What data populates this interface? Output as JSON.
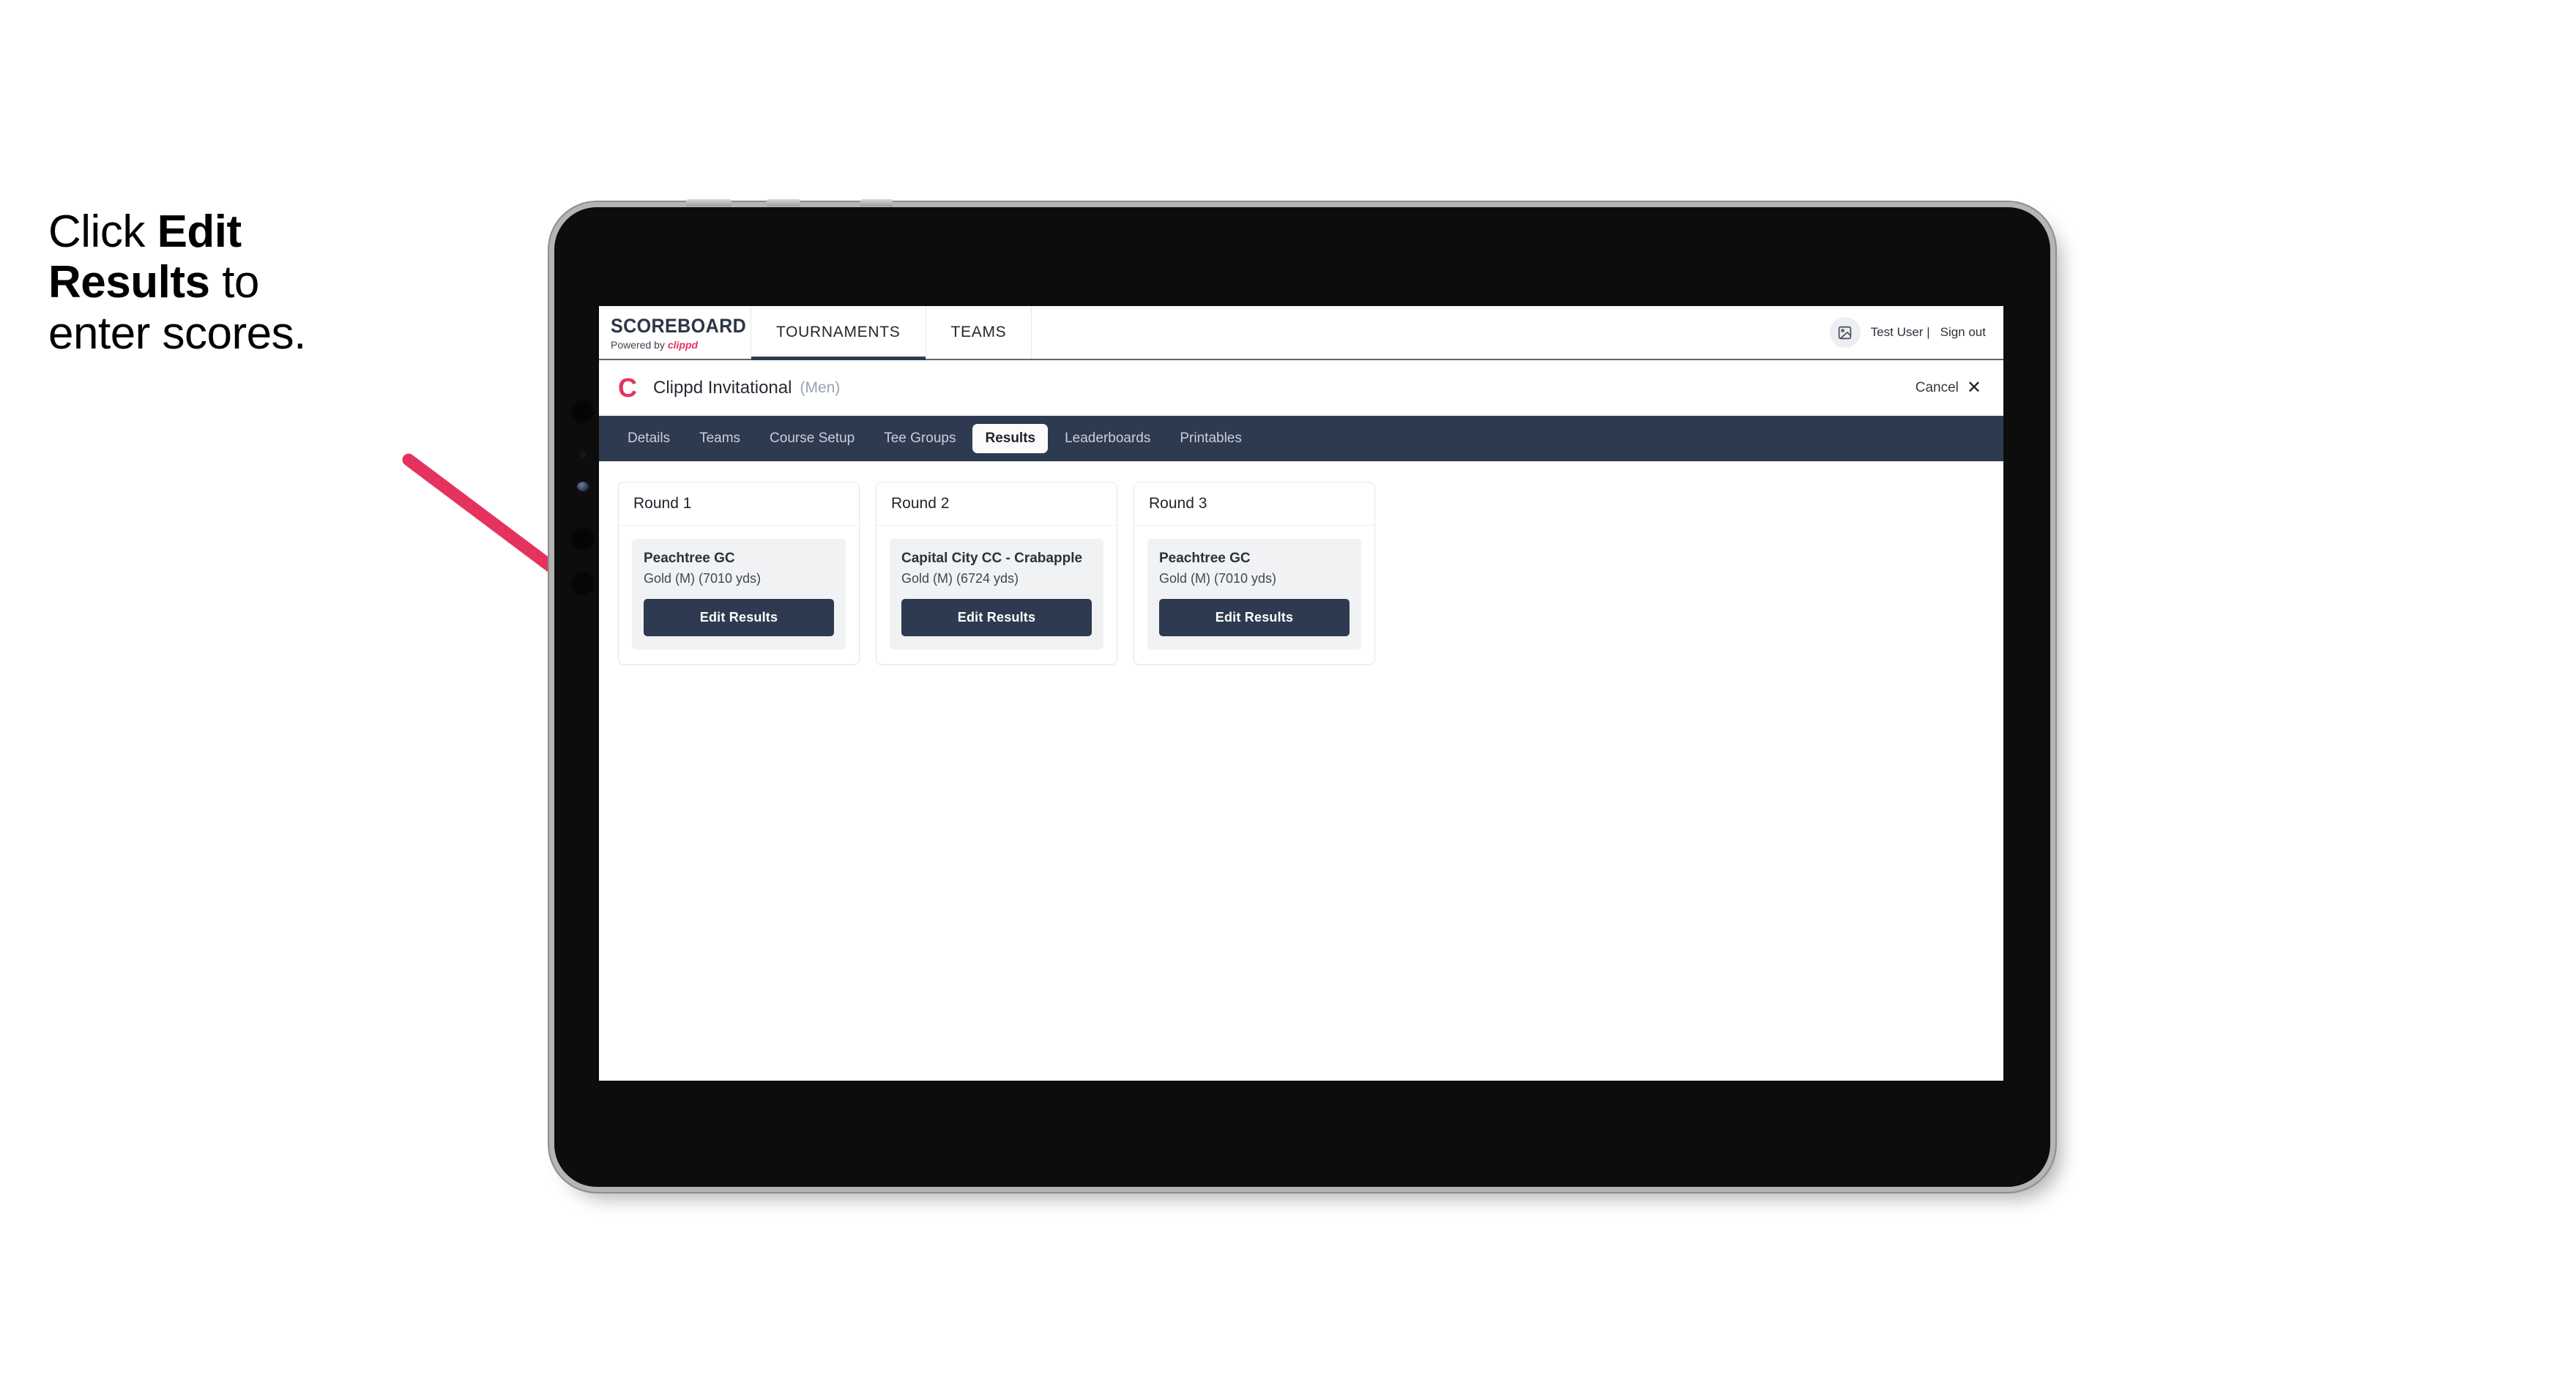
{
  "annotation": {
    "line1_prefix": "Click ",
    "line1_bold": "Edit",
    "line2_bold": "Results",
    "line2_suffix": " to",
    "line3": "enter scores.",
    "arrow_color": "#e5335f"
  },
  "topbar": {
    "brand_title": "SCOREBOARD",
    "brand_powered_prefix": "Powered by ",
    "brand_powered_name": "clippd",
    "tabs": [
      {
        "label": "TOURNAMENTS",
        "active": true
      },
      {
        "label": "TEAMS",
        "active": false
      }
    ],
    "avatar_icon": "image-placeholder-icon",
    "user_name": "Test User |",
    "sign_out": "Sign out"
  },
  "subheader": {
    "logo_letter": "C",
    "tournament_name": "Clippd Invitational",
    "gender": "(Men)",
    "cancel_label": "Cancel",
    "cancel_icon": "close-x-icon"
  },
  "tabstrip": {
    "tabs": [
      {
        "label": "Details",
        "active": false
      },
      {
        "label": "Teams",
        "active": false
      },
      {
        "label": "Course Setup",
        "active": false
      },
      {
        "label": "Tee Groups",
        "active": false
      },
      {
        "label": "Results",
        "active": true
      },
      {
        "label": "Leaderboards",
        "active": false
      },
      {
        "label": "Printables",
        "active": false
      }
    ]
  },
  "rounds": [
    {
      "header": "Round 1",
      "course_name": "Peachtree GC",
      "tee_info": "Gold (M) (7010 yds)",
      "button_label": "Edit Results"
    },
    {
      "header": "Round 2",
      "course_name": "Capital City CC - Crabapple",
      "tee_info": "Gold (M) (6724 yds)",
      "button_label": "Edit Results"
    },
    {
      "header": "Round 3",
      "course_name": "Peachtree GC",
      "tee_info": "Gold (M) (7010 yds)",
      "button_label": "Edit Results"
    }
  ],
  "theme": {
    "navy": "#2e3a4f",
    "accent_pink": "#e5335f",
    "page_bg": "#ffffff",
    "panel_gray": "#f1f2f4"
  }
}
